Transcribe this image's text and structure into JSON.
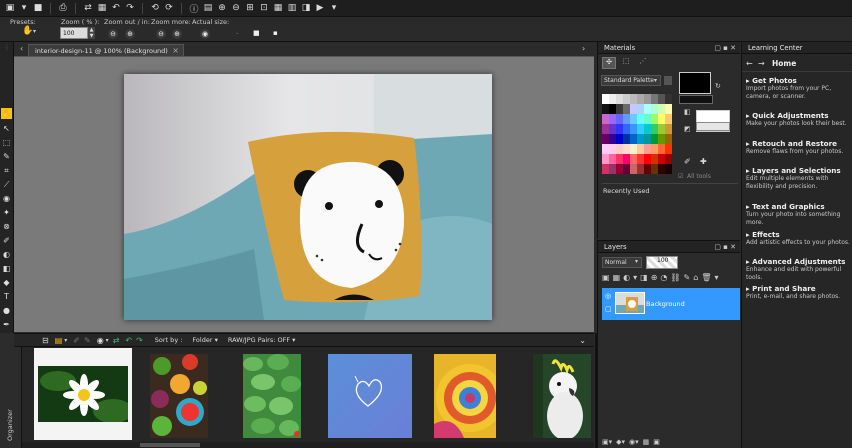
{
  "options_bar": {
    "presets_label": "Presets:",
    "zoom_label": "Zoom ( % ):",
    "zoom_value": "100",
    "zoom_out_in_label": "Zoom out / in:",
    "zoom_more_label": "Zoom more:",
    "actual_size_label": "Actual size:"
  },
  "document_tab": {
    "title": "interior-design-11 @ 100% (Background)",
    "close": "×"
  },
  "organizer": {
    "side_label": "Organizer",
    "sort_by_label": "Sort by :",
    "folder_dropdown": "Folder ▾",
    "raw_pairs_dropdown": "RAW/JPG Pairs: OFF ▾"
  },
  "materials": {
    "title": "Materials",
    "palette_dropdown": "Standard Palette",
    "all_tools": "All tools",
    "recently_used": "Recently Used",
    "swatch_colors": [
      [
        "#ffffff",
        "#eeeeee",
        "#dddddd",
        "#cccccc",
        "#bbbbbb",
        "#aaaaaa",
        "#999999",
        "#777777",
        "#555555",
        "#333333"
      ],
      [
        "#111111",
        "#000000",
        "#3a3a3a",
        "#6a6a6a",
        "#c7c7ff",
        "#aad4ff",
        "#aaffff",
        "#aaffd4",
        "#d4ffaa",
        "#ffffaa"
      ],
      [
        "#cc66cc",
        "#9966ff",
        "#6666ff",
        "#6699ff",
        "#66ccff",
        "#66ffff",
        "#66ffcc",
        "#99ff66",
        "#ffff66",
        "#ffcc66"
      ],
      [
        "#993399",
        "#6633cc",
        "#3333ff",
        "#3366ff",
        "#3399ff",
        "#33ccff",
        "#00cccc",
        "#33cc66",
        "#99cc33",
        "#cc9933"
      ],
      [
        "#660066",
        "#330099",
        "#0000cc",
        "#003399",
        "#0066cc",
        "#0099cc",
        "#009999",
        "#009933",
        "#669900",
        "#996600"
      ],
      [
        "#ffccff",
        "#ffccee",
        "#ffcccc",
        "#ffddcc",
        "#ffeecc",
        "#ffcc99",
        "#ff9999",
        "#ff9966",
        "#ff6633",
        "#ff3300"
      ],
      [
        "#ff99cc",
        "#ff6699",
        "#ff3366",
        "#ff0066",
        "#ff6666",
        "#ff3333",
        "#ff0000",
        "#cc3300",
        "#cc0000",
        "#990000"
      ],
      [
        "#cc3366",
        "#993366",
        "#990033",
        "#660033",
        "#cc6666",
        "#993333",
        "#660000",
        "#663300",
        "#330000",
        "#1a0000"
      ]
    ]
  },
  "layers": {
    "title": "Layers",
    "blend_mode": "Normal",
    "opacity": "100",
    "layer_name": "Background"
  },
  "learning_center": {
    "title": "Learning Center",
    "home": "Home",
    "items": [
      {
        "title": "Get Photos",
        "desc": "Import photos from your PC, camera, or scanner."
      },
      {
        "title": "Quick Adjustments",
        "desc": "Make your photos look their best."
      },
      {
        "title": "Retouch and Restore",
        "desc": "Remove flaws from your photos."
      },
      {
        "title": "Layers and Selections",
        "desc": "Edit multiple elements with flexibility and precision."
      },
      {
        "title": "Text and Graphics",
        "desc": "Turn your photo into something more."
      },
      {
        "title": "Effects",
        "desc": "Add artistic effects to your photos."
      },
      {
        "title": "Advanced Adjustments",
        "desc": "Enhance and edit with powerful tools."
      },
      {
        "title": "Print and Share",
        "desc": "Print, e-mail, and share photos."
      }
    ]
  },
  "colors": {
    "selection_blue": "#3399ff",
    "pillow_mustard": "#d6a03c",
    "sofa_teal": "#6fa8b5"
  }
}
